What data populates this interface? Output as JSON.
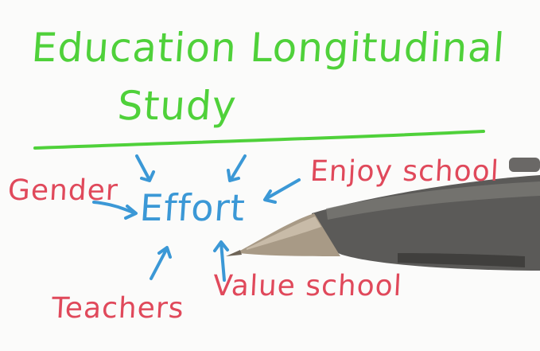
{
  "title": {
    "line1": "Education Longitudinal",
    "line2": "Study"
  },
  "center": "Effort",
  "factors": {
    "gender": "Gender",
    "enjoy_school": "Enjoy school",
    "teachers": "Teachers",
    "value_school": "Value school"
  },
  "colors": {
    "title": "#4fd13a",
    "factors": "#e0495b",
    "center_and_arrows": "#3b98d6",
    "underline": "#4fd13a"
  }
}
